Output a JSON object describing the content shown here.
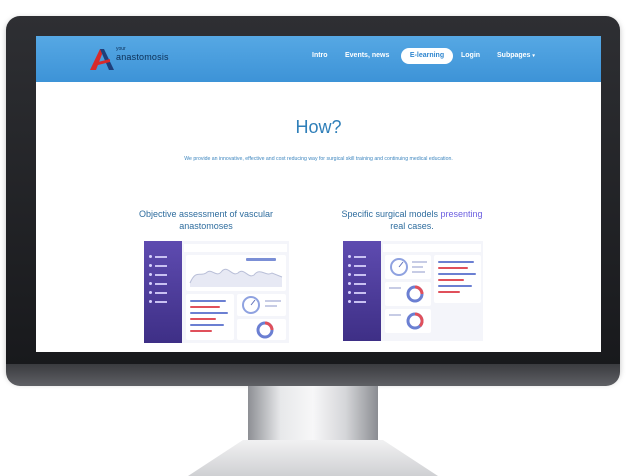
{
  "brand": {
    "name_small": "your",
    "name": "anastomosis",
    "logo_colors": [
      "#d72a2a",
      "#1f3f7a"
    ]
  },
  "nav": {
    "items": [
      "Intro",
      "Events, news",
      "E-learning",
      "Login",
      "Subpages"
    ],
    "active": "E-learning",
    "subpages_caret": "▾"
  },
  "hero": {
    "title": "How?",
    "text": "We provide an innovative, effective and cost reducing way for surgical skill training and continuing medical education."
  },
  "columns": [
    {
      "title": "Objective assessment of vascular anastomoses",
      "accent": ""
    },
    {
      "title": "Specific surgical models ",
      "accent": "presenting",
      "title_end": "real cases."
    }
  ],
  "colors": {
    "nav_bg": "#3d93d7",
    "heading": "#2f7fb9",
    "accent_purple": "#6b5ee0",
    "dashboard_sidebar": "#4b3b9a"
  }
}
